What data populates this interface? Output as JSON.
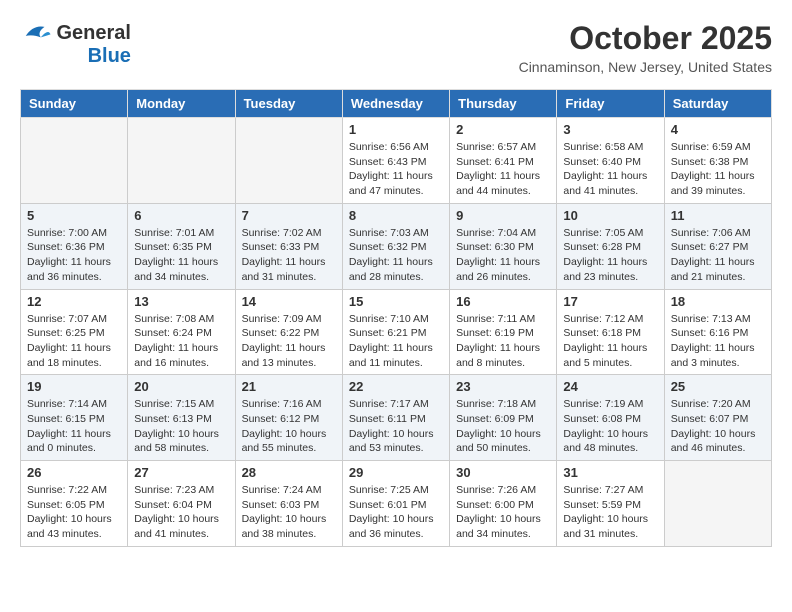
{
  "logo": {
    "text_general": "General",
    "text_blue": "Blue"
  },
  "header": {
    "month_title": "October 2025",
    "location": "Cinnaminson, New Jersey, United States"
  },
  "weekdays": [
    "Sunday",
    "Monday",
    "Tuesday",
    "Wednesday",
    "Thursday",
    "Friday",
    "Saturday"
  ],
  "weeks": [
    [
      {
        "day": "",
        "sunrise": "",
        "sunset": "",
        "daylight": ""
      },
      {
        "day": "",
        "sunrise": "",
        "sunset": "",
        "daylight": ""
      },
      {
        "day": "",
        "sunrise": "",
        "sunset": "",
        "daylight": ""
      },
      {
        "day": "1",
        "sunrise": "Sunrise: 6:56 AM",
        "sunset": "Sunset: 6:43 PM",
        "daylight": "Daylight: 11 hours and 47 minutes."
      },
      {
        "day": "2",
        "sunrise": "Sunrise: 6:57 AM",
        "sunset": "Sunset: 6:41 PM",
        "daylight": "Daylight: 11 hours and 44 minutes."
      },
      {
        "day": "3",
        "sunrise": "Sunrise: 6:58 AM",
        "sunset": "Sunset: 6:40 PM",
        "daylight": "Daylight: 11 hours and 41 minutes."
      },
      {
        "day": "4",
        "sunrise": "Sunrise: 6:59 AM",
        "sunset": "Sunset: 6:38 PM",
        "daylight": "Daylight: 11 hours and 39 minutes."
      }
    ],
    [
      {
        "day": "5",
        "sunrise": "Sunrise: 7:00 AM",
        "sunset": "Sunset: 6:36 PM",
        "daylight": "Daylight: 11 hours and 36 minutes."
      },
      {
        "day": "6",
        "sunrise": "Sunrise: 7:01 AM",
        "sunset": "Sunset: 6:35 PM",
        "daylight": "Daylight: 11 hours and 34 minutes."
      },
      {
        "day": "7",
        "sunrise": "Sunrise: 7:02 AM",
        "sunset": "Sunset: 6:33 PM",
        "daylight": "Daylight: 11 hours and 31 minutes."
      },
      {
        "day": "8",
        "sunrise": "Sunrise: 7:03 AM",
        "sunset": "Sunset: 6:32 PM",
        "daylight": "Daylight: 11 hours and 28 minutes."
      },
      {
        "day": "9",
        "sunrise": "Sunrise: 7:04 AM",
        "sunset": "Sunset: 6:30 PM",
        "daylight": "Daylight: 11 hours and 26 minutes."
      },
      {
        "day": "10",
        "sunrise": "Sunrise: 7:05 AM",
        "sunset": "Sunset: 6:28 PM",
        "daylight": "Daylight: 11 hours and 23 minutes."
      },
      {
        "day": "11",
        "sunrise": "Sunrise: 7:06 AM",
        "sunset": "Sunset: 6:27 PM",
        "daylight": "Daylight: 11 hours and 21 minutes."
      }
    ],
    [
      {
        "day": "12",
        "sunrise": "Sunrise: 7:07 AM",
        "sunset": "Sunset: 6:25 PM",
        "daylight": "Daylight: 11 hours and 18 minutes."
      },
      {
        "day": "13",
        "sunrise": "Sunrise: 7:08 AM",
        "sunset": "Sunset: 6:24 PM",
        "daylight": "Daylight: 11 hours and 16 minutes."
      },
      {
        "day": "14",
        "sunrise": "Sunrise: 7:09 AM",
        "sunset": "Sunset: 6:22 PM",
        "daylight": "Daylight: 11 hours and 13 minutes."
      },
      {
        "day": "15",
        "sunrise": "Sunrise: 7:10 AM",
        "sunset": "Sunset: 6:21 PM",
        "daylight": "Daylight: 11 hours and 11 minutes."
      },
      {
        "day": "16",
        "sunrise": "Sunrise: 7:11 AM",
        "sunset": "Sunset: 6:19 PM",
        "daylight": "Daylight: 11 hours and 8 minutes."
      },
      {
        "day": "17",
        "sunrise": "Sunrise: 7:12 AM",
        "sunset": "Sunset: 6:18 PM",
        "daylight": "Daylight: 11 hours and 5 minutes."
      },
      {
        "day": "18",
        "sunrise": "Sunrise: 7:13 AM",
        "sunset": "Sunset: 6:16 PM",
        "daylight": "Daylight: 11 hours and 3 minutes."
      }
    ],
    [
      {
        "day": "19",
        "sunrise": "Sunrise: 7:14 AM",
        "sunset": "Sunset: 6:15 PM",
        "daylight": "Daylight: 11 hours and 0 minutes."
      },
      {
        "day": "20",
        "sunrise": "Sunrise: 7:15 AM",
        "sunset": "Sunset: 6:13 PM",
        "daylight": "Daylight: 10 hours and 58 minutes."
      },
      {
        "day": "21",
        "sunrise": "Sunrise: 7:16 AM",
        "sunset": "Sunset: 6:12 PM",
        "daylight": "Daylight: 10 hours and 55 minutes."
      },
      {
        "day": "22",
        "sunrise": "Sunrise: 7:17 AM",
        "sunset": "Sunset: 6:11 PM",
        "daylight": "Daylight: 10 hours and 53 minutes."
      },
      {
        "day": "23",
        "sunrise": "Sunrise: 7:18 AM",
        "sunset": "Sunset: 6:09 PM",
        "daylight": "Daylight: 10 hours and 50 minutes."
      },
      {
        "day": "24",
        "sunrise": "Sunrise: 7:19 AM",
        "sunset": "Sunset: 6:08 PM",
        "daylight": "Daylight: 10 hours and 48 minutes."
      },
      {
        "day": "25",
        "sunrise": "Sunrise: 7:20 AM",
        "sunset": "Sunset: 6:07 PM",
        "daylight": "Daylight: 10 hours and 46 minutes."
      }
    ],
    [
      {
        "day": "26",
        "sunrise": "Sunrise: 7:22 AM",
        "sunset": "Sunset: 6:05 PM",
        "daylight": "Daylight: 10 hours and 43 minutes."
      },
      {
        "day": "27",
        "sunrise": "Sunrise: 7:23 AM",
        "sunset": "Sunset: 6:04 PM",
        "daylight": "Daylight: 10 hours and 41 minutes."
      },
      {
        "day": "28",
        "sunrise": "Sunrise: 7:24 AM",
        "sunset": "Sunset: 6:03 PM",
        "daylight": "Daylight: 10 hours and 38 minutes."
      },
      {
        "day": "29",
        "sunrise": "Sunrise: 7:25 AM",
        "sunset": "Sunset: 6:01 PM",
        "daylight": "Daylight: 10 hours and 36 minutes."
      },
      {
        "day": "30",
        "sunrise": "Sunrise: 7:26 AM",
        "sunset": "Sunset: 6:00 PM",
        "daylight": "Daylight: 10 hours and 34 minutes."
      },
      {
        "day": "31",
        "sunrise": "Sunrise: 7:27 AM",
        "sunset": "Sunset: 5:59 PM",
        "daylight": "Daylight: 10 hours and 31 minutes."
      },
      {
        "day": "",
        "sunrise": "",
        "sunset": "",
        "daylight": ""
      }
    ]
  ]
}
